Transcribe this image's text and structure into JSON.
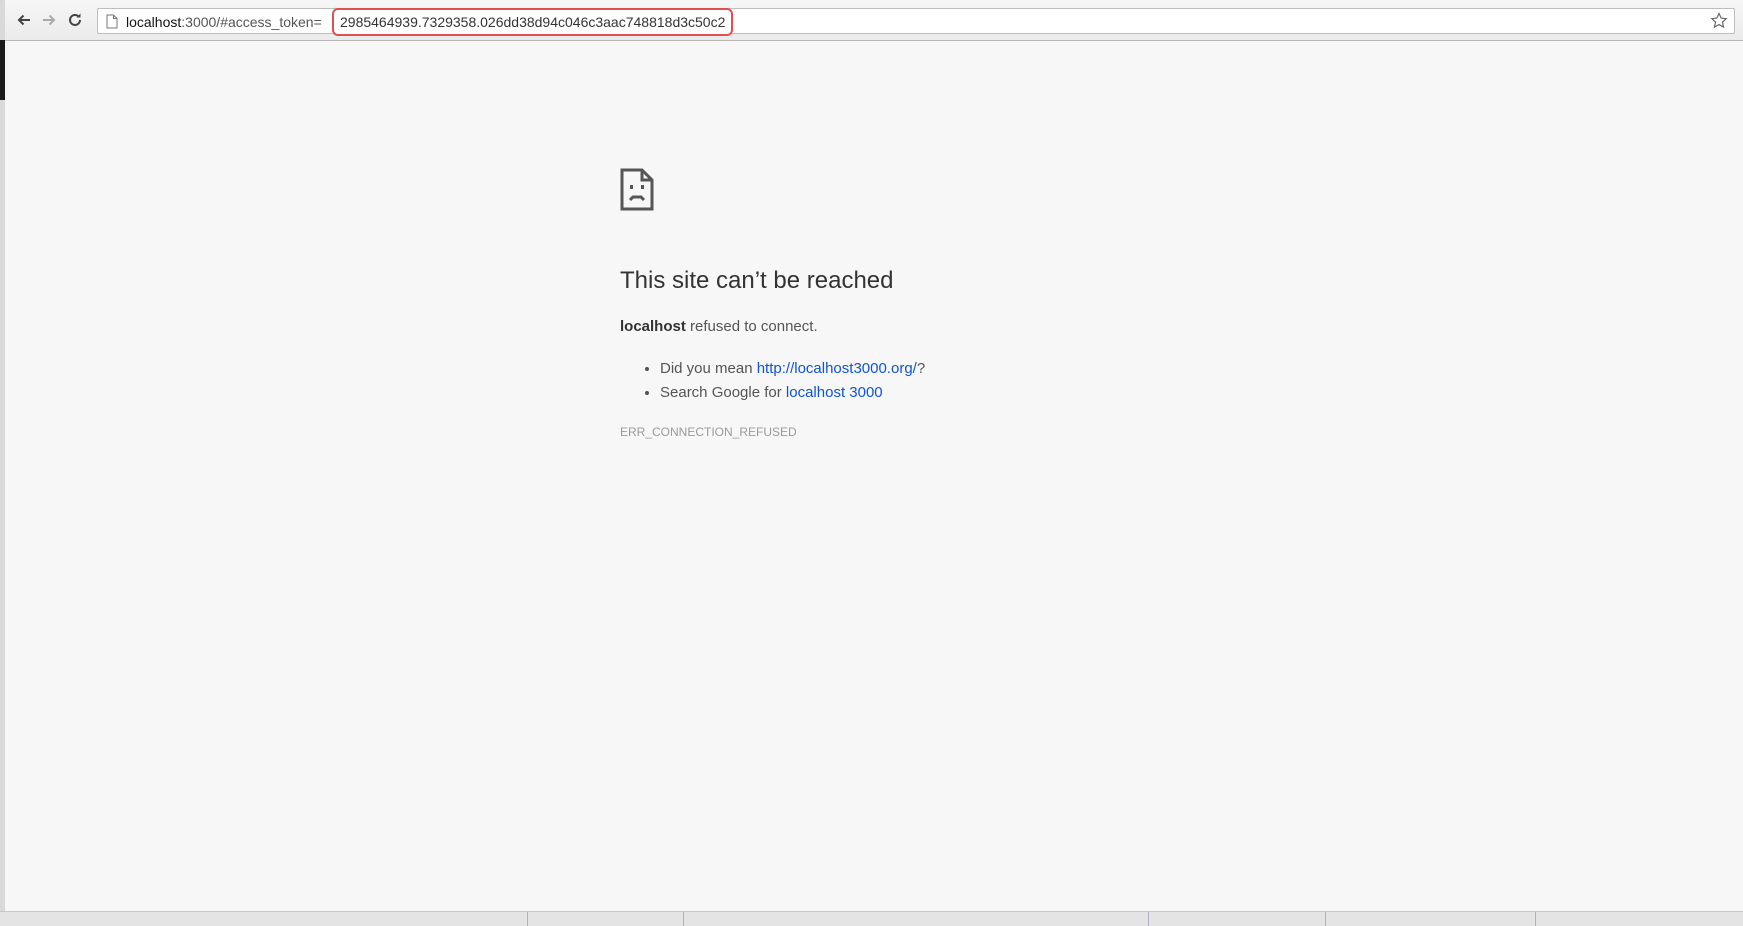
{
  "browser": {
    "url_prefix": "localhost",
    "url_path": ":3000/#access_token=",
    "access_token": "2985464939.7329358.026dd38d94c046c3aac748818d3c50c2"
  },
  "error": {
    "title": "This site can’t be reached",
    "host": "localhost",
    "message": " refused to connect.",
    "suggestions": [
      {
        "prefix": "Did you mean ",
        "link": "http://localhost3000.org/",
        "suffix": "?"
      },
      {
        "prefix": "Search Google for ",
        "link": "localhost 3000",
        "suffix": ""
      }
    ],
    "code": "ERR_CONNECTION_REFUSED"
  },
  "icons": [
    "back-arrow-icon",
    "forward-arrow-icon",
    "reload-icon",
    "page-icon",
    "bookmark-star-icon",
    "sad-page-icon"
  ]
}
